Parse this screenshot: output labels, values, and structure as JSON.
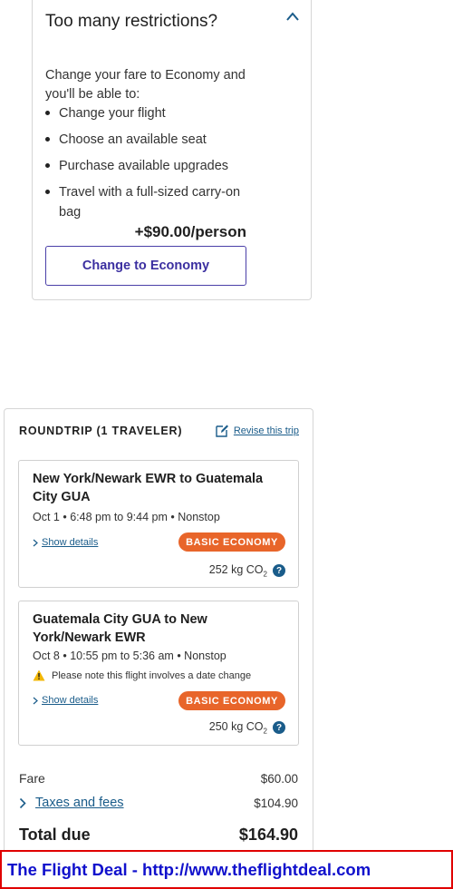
{
  "upsell": {
    "title": "Too many restrictions?",
    "intro": "Change your fare to Economy and you'll be able to:",
    "benefits": [
      "Change your flight",
      "Choose an available seat",
      "Purchase available upgrades",
      "Travel with a full-sized carry-on bag"
    ],
    "price": "+$90.00/person",
    "button_label": "Change to Economy",
    "collapse_icon": "chevron-up-icon"
  },
  "summary": {
    "heading": "ROUNDTRIP (1 TRAVELER)",
    "revise_label": "Revise this trip",
    "flights": [
      {
        "route": "New York/Newark EWR to Guatemala City GUA",
        "times": "Oct 1 • 6:48 pm to 9:44 pm • Nonstop",
        "details_label": "Show details",
        "fare_badge": "BASIC ECONOMY",
        "co2": "252 kg CO",
        "co2_sub": "2",
        "notice": ""
      },
      {
        "route": "Guatemala City GUA to New York/Newark EWR",
        "times": "Oct 8 • 10:55 pm to 5:36 am • Nonstop",
        "notice": "Please note this flight involves a date change",
        "details_label": "Show details",
        "fare_badge": "BASIC ECONOMY",
        "co2": "250 kg CO",
        "co2_sub": "2"
      }
    ],
    "fare_label": "Fare",
    "fare_value": "$60.00",
    "taxes_label": "Taxes and fees",
    "taxes_value": "$104.90",
    "total_label": "Total due",
    "total_value": "$164.90"
  },
  "banner": {
    "text": "The Flight Deal - http://www.theflightdeal.com"
  },
  "colors": {
    "accent_purple": "#3b2fa0",
    "link_blue": "#1a5c8a",
    "badge_orange": "#e8652a",
    "banner_red": "#e00000",
    "banner_text": "#1010cc"
  }
}
